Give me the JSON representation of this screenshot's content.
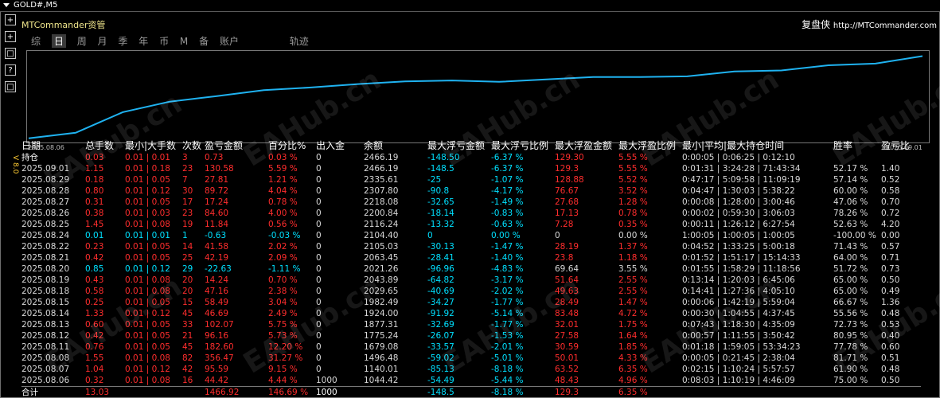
{
  "window_title": "GOLD#,M5",
  "toolbar_labels": [
    "+",
    "+",
    "□",
    "?",
    "□"
  ],
  "side_label": "V 8.0",
  "brand": "MTCommander资管",
  "brand_right": "复盘侠",
  "brand_url": "http://MTCommander.com",
  "tabs": [
    "综",
    "日",
    "周",
    "月",
    "季",
    "年",
    "币",
    "M",
    "备",
    "账户",
    "轨迹"
  ],
  "active_tab": "日",
  "watermark": "EAHub.cn",
  "chart_data": {
    "type": "line",
    "x_start_label": "2025.08.06",
    "x_end_label": "2025.09.01",
    "x": [
      "2025.08.06",
      "2025.08.07",
      "2025.08.08",
      "2025.08.11",
      "2025.08.12",
      "2025.08.13",
      "2025.08.14",
      "2025.08.15",
      "2025.08.18",
      "2025.08.19",
      "2025.08.20",
      "2025.08.21",
      "2025.08.22",
      "2025.08.24",
      "2025.08.25",
      "2025.08.26",
      "2025.08.27",
      "2025.08.28",
      "2025.08.29",
      "2025.09.01"
    ],
    "values": [
      1044.42,
      1140.01,
      1496.48,
      1679.08,
      1775.24,
      1877.31,
      1924.0,
      1982.49,
      2029.65,
      2043.89,
      2021.26,
      2063.45,
      2105.03,
      2104.4,
      2116.24,
      2200.84,
      2218.08,
      2307.8,
      2335.61,
      2466.19
    ],
    "color": "#1fb2f0",
    "ylim": [
      1000,
      2500
    ]
  },
  "table": {
    "headers": [
      "日期",
      "总手数",
      "最小|大手数",
      "次数",
      "盈亏金额",
      "百分比%",
      "出入金",
      "余额",
      "最大浮亏金额",
      "最大浮亏比例",
      "最大浮盈金额",
      "最大浮盈比例",
      "最小|平均|最大持仓时间",
      "胜率",
      "盈亏比"
    ],
    "rows": [
      {
        "cells": [
          "持仓",
          "0.03",
          "0.01 | 0.01",
          "3",
          "0.73",
          "0.03 %",
          "0",
          "2466.19",
          "-148.50",
          "-6.37 %",
          "129.30",
          "5.55 %",
          "0:00:05 | 0:06:25 | 0:12:10",
          "",
          ""
        ],
        "tone": "red"
      },
      {
        "cells": [
          "2025.09.01",
          "1.15",
          "0.01 | 0.18",
          "23",
          "130.58",
          "5.59 %",
          "0",
          "2466.19",
          "-148.5",
          "-6.37 %",
          "129.3",
          "5.55 %",
          "0:01:31 | 3:24:28 | 71:43:34",
          "52.17 %",
          "1.40"
        ],
        "tone": "red"
      },
      {
        "cells": [
          "2025.08.29",
          "0.18",
          "0.01 | 0.05",
          "7",
          "27.81",
          "1.21 %",
          "0",
          "2335.61",
          "-25",
          "-1.07 %",
          "128.88",
          "5.52 %",
          "0:47:17 | 5:09:58 | 11:09:19",
          "57.14 %",
          "0.52"
        ],
        "tone": "red"
      },
      {
        "cells": [
          "2025.08.28",
          "0.80",
          "0.01 | 0.12",
          "30",
          "89.72",
          "4.04 %",
          "0",
          "2307.80",
          "-90.8",
          "-4.17 %",
          "76.67",
          "3.52 %",
          "0:04:47 | 1:30:03 | 5:38:22",
          "60.00 %",
          "0.58"
        ],
        "tone": "red"
      },
      {
        "cells": [
          "2025.08.27",
          "0.31",
          "0.01 | 0.05",
          "17",
          "17.24",
          "0.78 %",
          "0",
          "2218.08",
          "-32.65",
          "-1.49 %",
          "27.68",
          "1.28 %",
          "0:00:08 | 1:28:00 | 3:00:46",
          "47.06 %",
          "0.70"
        ],
        "tone": "red"
      },
      {
        "cells": [
          "2025.08.26",
          "0.38",
          "0.01 | 0.03",
          "23",
          "84.60",
          "4.00 %",
          "0",
          "2200.84",
          "-18.14",
          "-0.83 %",
          "17.13",
          "0.78 %",
          "0:00:02 | 0:59:30 | 3:06:03",
          "78.26 %",
          "0.72"
        ],
        "tone": "red"
      },
      {
        "cells": [
          "2025.08.25",
          "1.45",
          "0.01 | 0.08",
          "19",
          "11.84",
          "0.56 %",
          "0",
          "2116.24",
          "-13.32",
          "-0.63 %",
          "7.28",
          "0.35 %",
          "0:00:11 | 1:26:12 | 6:27:54",
          "52.63 %",
          "4.20"
        ],
        "tone": "red"
      },
      {
        "cells": [
          "2025.08.24",
          "0.01",
          "0.01 | 0.01",
          "1",
          "-0.63",
          "-0.03 %",
          "0",
          "2104.40",
          "0",
          "0.00 %",
          "0",
          "0.00 %",
          "1:00:05 | 1:00:05 | 1:00:05",
          "-100.00 %",
          "0.00"
        ],
        "tone": "cyan"
      },
      {
        "cells": [
          "2025.08.22",
          "0.23",
          "0.01 | 0.05",
          "14",
          "41.58",
          "2.02 %",
          "0",
          "2105.03",
          "-30.13",
          "-1.47 %",
          "28.19",
          "1.37 %",
          "0:04:52 | 1:33:25 | 5:00:18",
          "71.43 %",
          "0.57"
        ],
        "tone": "red"
      },
      {
        "cells": [
          "2025.08.21",
          "0.42",
          "0.01 | 0.05",
          "25",
          "42.19",
          "2.09 %",
          "0",
          "2063.45",
          "-28.41",
          "-1.40 %",
          "23.8",
          "1.18 %",
          "0:01:52 | 1:51:17 | 15:14:33",
          "64.00 %",
          "0.71"
        ],
        "tone": "red"
      },
      {
        "cells": [
          "2025.08.20",
          "0.85",
          "0.01 | 0.12",
          "29",
          "-22.63",
          "-1.11 %",
          "0",
          "2021.26",
          "-96.96",
          "-4.83 %",
          "69.64",
          "3.55 %",
          "0:01:55 | 1:58:29 | 11:18:56",
          "51.72 %",
          "0.73"
        ],
        "tone": "cyan"
      },
      {
        "cells": [
          "2025.08.19",
          "0.43",
          "0.01 | 0.08",
          "20",
          "14.24",
          "0.70 %",
          "0",
          "2043.89",
          "-64.82",
          "-3.17 %",
          "51.64",
          "2.55 %",
          "0:13:14 | 1:20:03 | 6:45:06",
          "65.00 %",
          "0.50"
        ],
        "tone": "red"
      },
      {
        "cells": [
          "2025.08.18",
          "0.58",
          "0.01 | 0.08",
          "20",
          "47.16",
          "2.38 %",
          "0",
          "2029.65",
          "-40.69",
          "-2.02 %",
          "49.63",
          "2.55 %",
          "0:14:41 | 1:27:36 | 4:05:10",
          "65.00 %",
          "0.49"
        ],
        "tone": "red"
      },
      {
        "cells": [
          "2025.08.15",
          "0.25",
          "0.01 | 0.05",
          "15",
          "58.49",
          "3.04 %",
          "0",
          "1982.49",
          "-34.27",
          "-1.77 %",
          "28.49",
          "1.47 %",
          "0:00:06 | 1:42:19 | 5:59:04",
          "66.67 %",
          "1.36"
        ],
        "tone": "red"
      },
      {
        "cells": [
          "2025.08.14",
          "1.33",
          "0.01 | 0.12",
          "45",
          "46.69",
          "2.49 %",
          "0",
          "1924.00",
          "-91.92",
          "-5.14 %",
          "83.48",
          "4.72 %",
          "0:00:30 | 1:04:55 | 4:37:45",
          "55.56 %",
          "0.48"
        ],
        "tone": "red"
      },
      {
        "cells": [
          "2025.08.13",
          "0.60",
          "0.01 | 0.05",
          "33",
          "102.07",
          "5.75 %",
          "0",
          "1877.31",
          "-32.69",
          "-1.77 %",
          "32.01",
          "1.75 %",
          "0:07:43 | 1:18:30 | 4:35:09",
          "72.73 %",
          "0.53"
        ],
        "tone": "red"
      },
      {
        "cells": [
          "2025.08.12",
          "0.42",
          "0.01 | 0.05",
          "21",
          "96.16",
          "5.73 %",
          "0",
          "1775.24",
          "-26.07",
          "-1.53 %",
          "27.58",
          "1.64 %",
          "0:00:57 | 1:11:55 | 3:50:42",
          "80.95 %",
          "0.40"
        ],
        "tone": "red"
      },
      {
        "cells": [
          "2025.08.11",
          "0.76",
          "0.01 | 0.05",
          "45",
          "182.60",
          "12.20 %",
          "0",
          "1679.08",
          "-33.57",
          "-2.01 %",
          "30.59",
          "1.85 %",
          "0:01:18 | 1:59:05 | 53:34:23",
          "77.78 %",
          "0.60"
        ],
        "tone": "red"
      },
      {
        "cells": [
          "2025.08.08",
          "1.55",
          "0.01 | 0.08",
          "82",
          "356.47",
          "31.27 %",
          "0",
          "1496.48",
          "-59.02",
          "-5.01 %",
          "50.01",
          "4.33 %",
          "0:00:05 | 0:21:45 | 2:38:04",
          "81.71 %",
          "0.51"
        ],
        "tone": "red"
      },
      {
        "cells": [
          "2025.08.07",
          "1.04",
          "0.01 | 0.12",
          "42",
          "95.59",
          "9.15 %",
          "0",
          "1140.01",
          "-85.13",
          "-8.18 %",
          "63.52",
          "6.35 %",
          "0:02:15 | 1:10:24 | 5:57:57",
          "61.90 %",
          "0.48"
        ],
        "tone": "red"
      },
      {
        "cells": [
          "2025.08.06",
          "0.32",
          "0.01 | 0.08",
          "16",
          "44.42",
          "4.44 %",
          "1000",
          "1044.42",
          "-54.49",
          "-5.44 %",
          "48.43",
          "4.96 %",
          "0:08:03 | 1:10:19 | 4:46:09",
          "75.00 %",
          "0.50"
        ],
        "tone": "red"
      }
    ],
    "total": {
      "cells": [
        "合计",
        "13.03",
        "",
        "",
        "1466.92",
        "146.69 %",
        "1000",
        "",
        "-148.5",
        "-8.18 %",
        "129.3",
        "6.35 %",
        "",
        "",
        ""
      ]
    }
  }
}
